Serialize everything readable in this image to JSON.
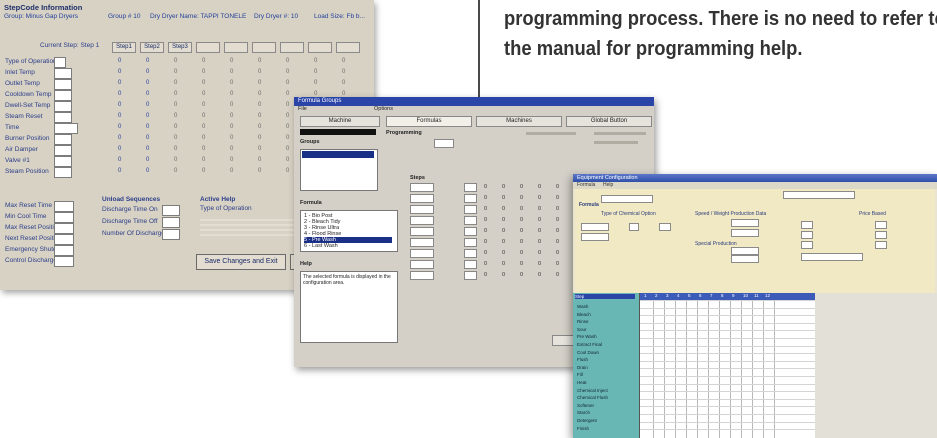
{
  "caption": {
    "line1": "programming process. There is no need to refer to",
    "line2": "the manual for programming help."
  },
  "window_stepcode": {
    "header": "StepCode Information",
    "bar": {
      "group": "Group: Minus Gap Dryers",
      "group_num": "Group # 10",
      "dryer_name": "Dry Dryer Name: TAPPI TONELE",
      "dryer_num": "Dry Dryer #: 10",
      "load_size": "Load Size: Fb b..."
    },
    "current_step": "Current Step: Step 1",
    "step_tabs": [
      "Step1",
      "Step2",
      "Step3",
      "",
      "",
      "",
      "",
      "",
      ""
    ],
    "param_labels": [
      "Type of Operation",
      "Inlet Temp",
      "Outlet Temp",
      "Cooldown Temp",
      "Dwell-Set Temp",
      "Steam Reset",
      "Time",
      "Burner Position",
      "Air Damper",
      "Valve #1",
      "Steam Position"
    ],
    "timer_labels": [
      "Max Reset Time",
      "Min Cool Time",
      "Max Reset Position",
      "Next Reset Position",
      "Emergency Shutdown",
      "Control Discharge"
    ],
    "discharge_title": "Unload Sequences",
    "discharge_labels": [
      "Discharge Time On",
      "Discharge Time Off",
      "Number Of Discharges"
    ],
    "active_help_title": "Active Help",
    "active_help_sub": "Type of Operation",
    "save_button": "Save Changes and Exit"
  },
  "window_formulas": {
    "title": "Formula Groups",
    "menu": [
      "File",
      "Options"
    ],
    "tabs": [
      "Machine",
      "Formulas",
      "Machines",
      "Global Button"
    ],
    "groups_label": "Groups",
    "programming_label": "Programming",
    "formula_label": "Formula",
    "help_label": "Help",
    "help_text": "The selected formula is displayed in the configuration area.",
    "formula_list": [
      "1 - Bio Post",
      "2 - Bleach Tidy",
      "3 - Rinse Ultra",
      "4 - Flood Rinse",
      "5 - Pre Wash",
      "6 - Last Wash"
    ],
    "steps_label": "Steps"
  },
  "window_config": {
    "title": "Equipment Configuration",
    "menu": [
      "Formula",
      "Help"
    ],
    "section_formula": "Formula",
    "section_chemical": "Type of Chemical Option",
    "section_speed": "Speed / Weight Production Data",
    "section_price": "Price Based",
    "section_special": "Special Production",
    "step_header": "Step",
    "sidebar_items": [
      "Wash",
      "Bleach",
      "Rinse",
      "Sour",
      "Pre Wash",
      "Extract Final",
      "Cool Down",
      "Flush",
      "Drain",
      "Fill",
      "Heat",
      "Chemical Inject",
      "Chemical Flush",
      "Softener",
      "Starch",
      "Detergent",
      "Finish"
    ],
    "col_numbers": [
      "1",
      "2",
      "3",
      "4",
      "5",
      "6",
      "7",
      "8",
      "9",
      "10",
      "11",
      "12"
    ]
  }
}
